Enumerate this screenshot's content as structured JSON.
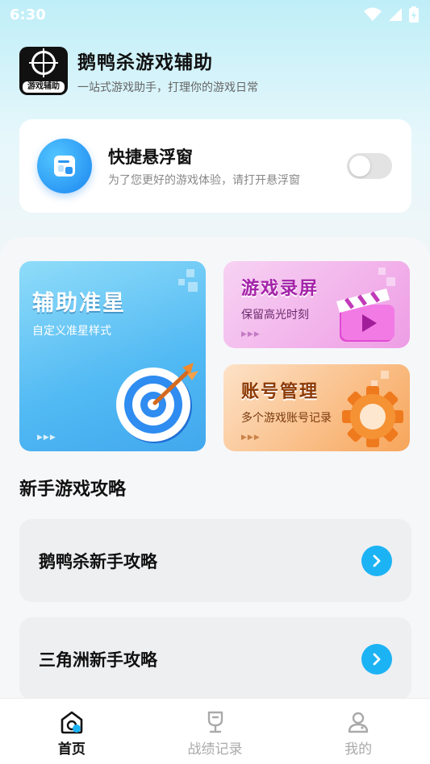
{
  "status_bar": {
    "time": "6:30"
  },
  "app": {
    "logo_text": "游戏辅助",
    "title": "鹅鸭杀游戏辅助",
    "subtitle": "一站式游戏助手，打理你的游戏日常"
  },
  "floating_window": {
    "title": "快捷悬浮窗",
    "description": "为了您更好的游戏体验，请打开悬浮窗",
    "enabled": false
  },
  "features": {
    "aim": {
      "title": "辅助准星",
      "desc": "自定义准星样式"
    },
    "record": {
      "title": "游戏录屏",
      "desc": "保留高光时刻"
    },
    "account": {
      "title": "账号管理",
      "desc": "多个游戏账号记录"
    },
    "dots": "▶▶▶"
  },
  "guides": {
    "section_title": "新手游戏攻略",
    "items": [
      {
        "label": "鹅鸭杀新手攻略"
      },
      {
        "label": "三角洲新手攻略"
      }
    ]
  },
  "nav": {
    "items": [
      {
        "label": "首页",
        "icon": "home-icon",
        "active": true
      },
      {
        "label": "战绩记录",
        "icon": "trophy-icon",
        "active": false
      },
      {
        "label": "我的",
        "icon": "user-icon",
        "active": false
      }
    ]
  },
  "colors": {
    "accent": "#1cb3f5",
    "toggle_off": "#e3e3e3"
  }
}
